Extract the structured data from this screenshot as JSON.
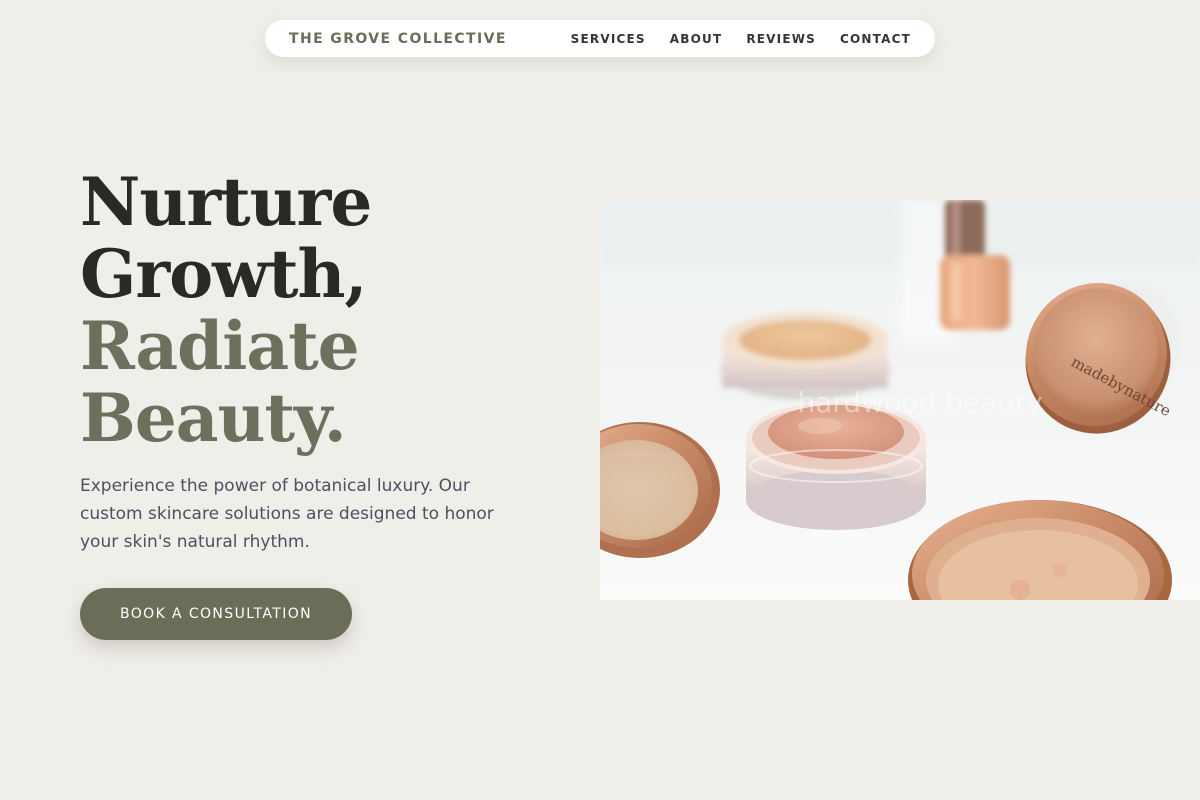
{
  "nav": {
    "brand": "THE GROVE COLLECTIVE",
    "links": [
      "SERVICES",
      "ABOUT",
      "REVIEWS",
      "CONTACT"
    ]
  },
  "hero": {
    "title_lines": [
      "Nurture",
      "Growth,",
      "Radiate",
      "Beauty."
    ],
    "description": "Experience the power of botanical luxury. Our custom skincare solutions are designed to honor your skin's natural rhythm.",
    "cta_label": "BOOK A CONSULTATION"
  },
  "image": {
    "jar_label": "madebynature",
    "watermark": "hardwood beauty"
  },
  "colors": {
    "background": "#f0eee9",
    "accent": "#6b6d58",
    "heading": "#2a2a25",
    "body_text": "#4c5060"
  }
}
